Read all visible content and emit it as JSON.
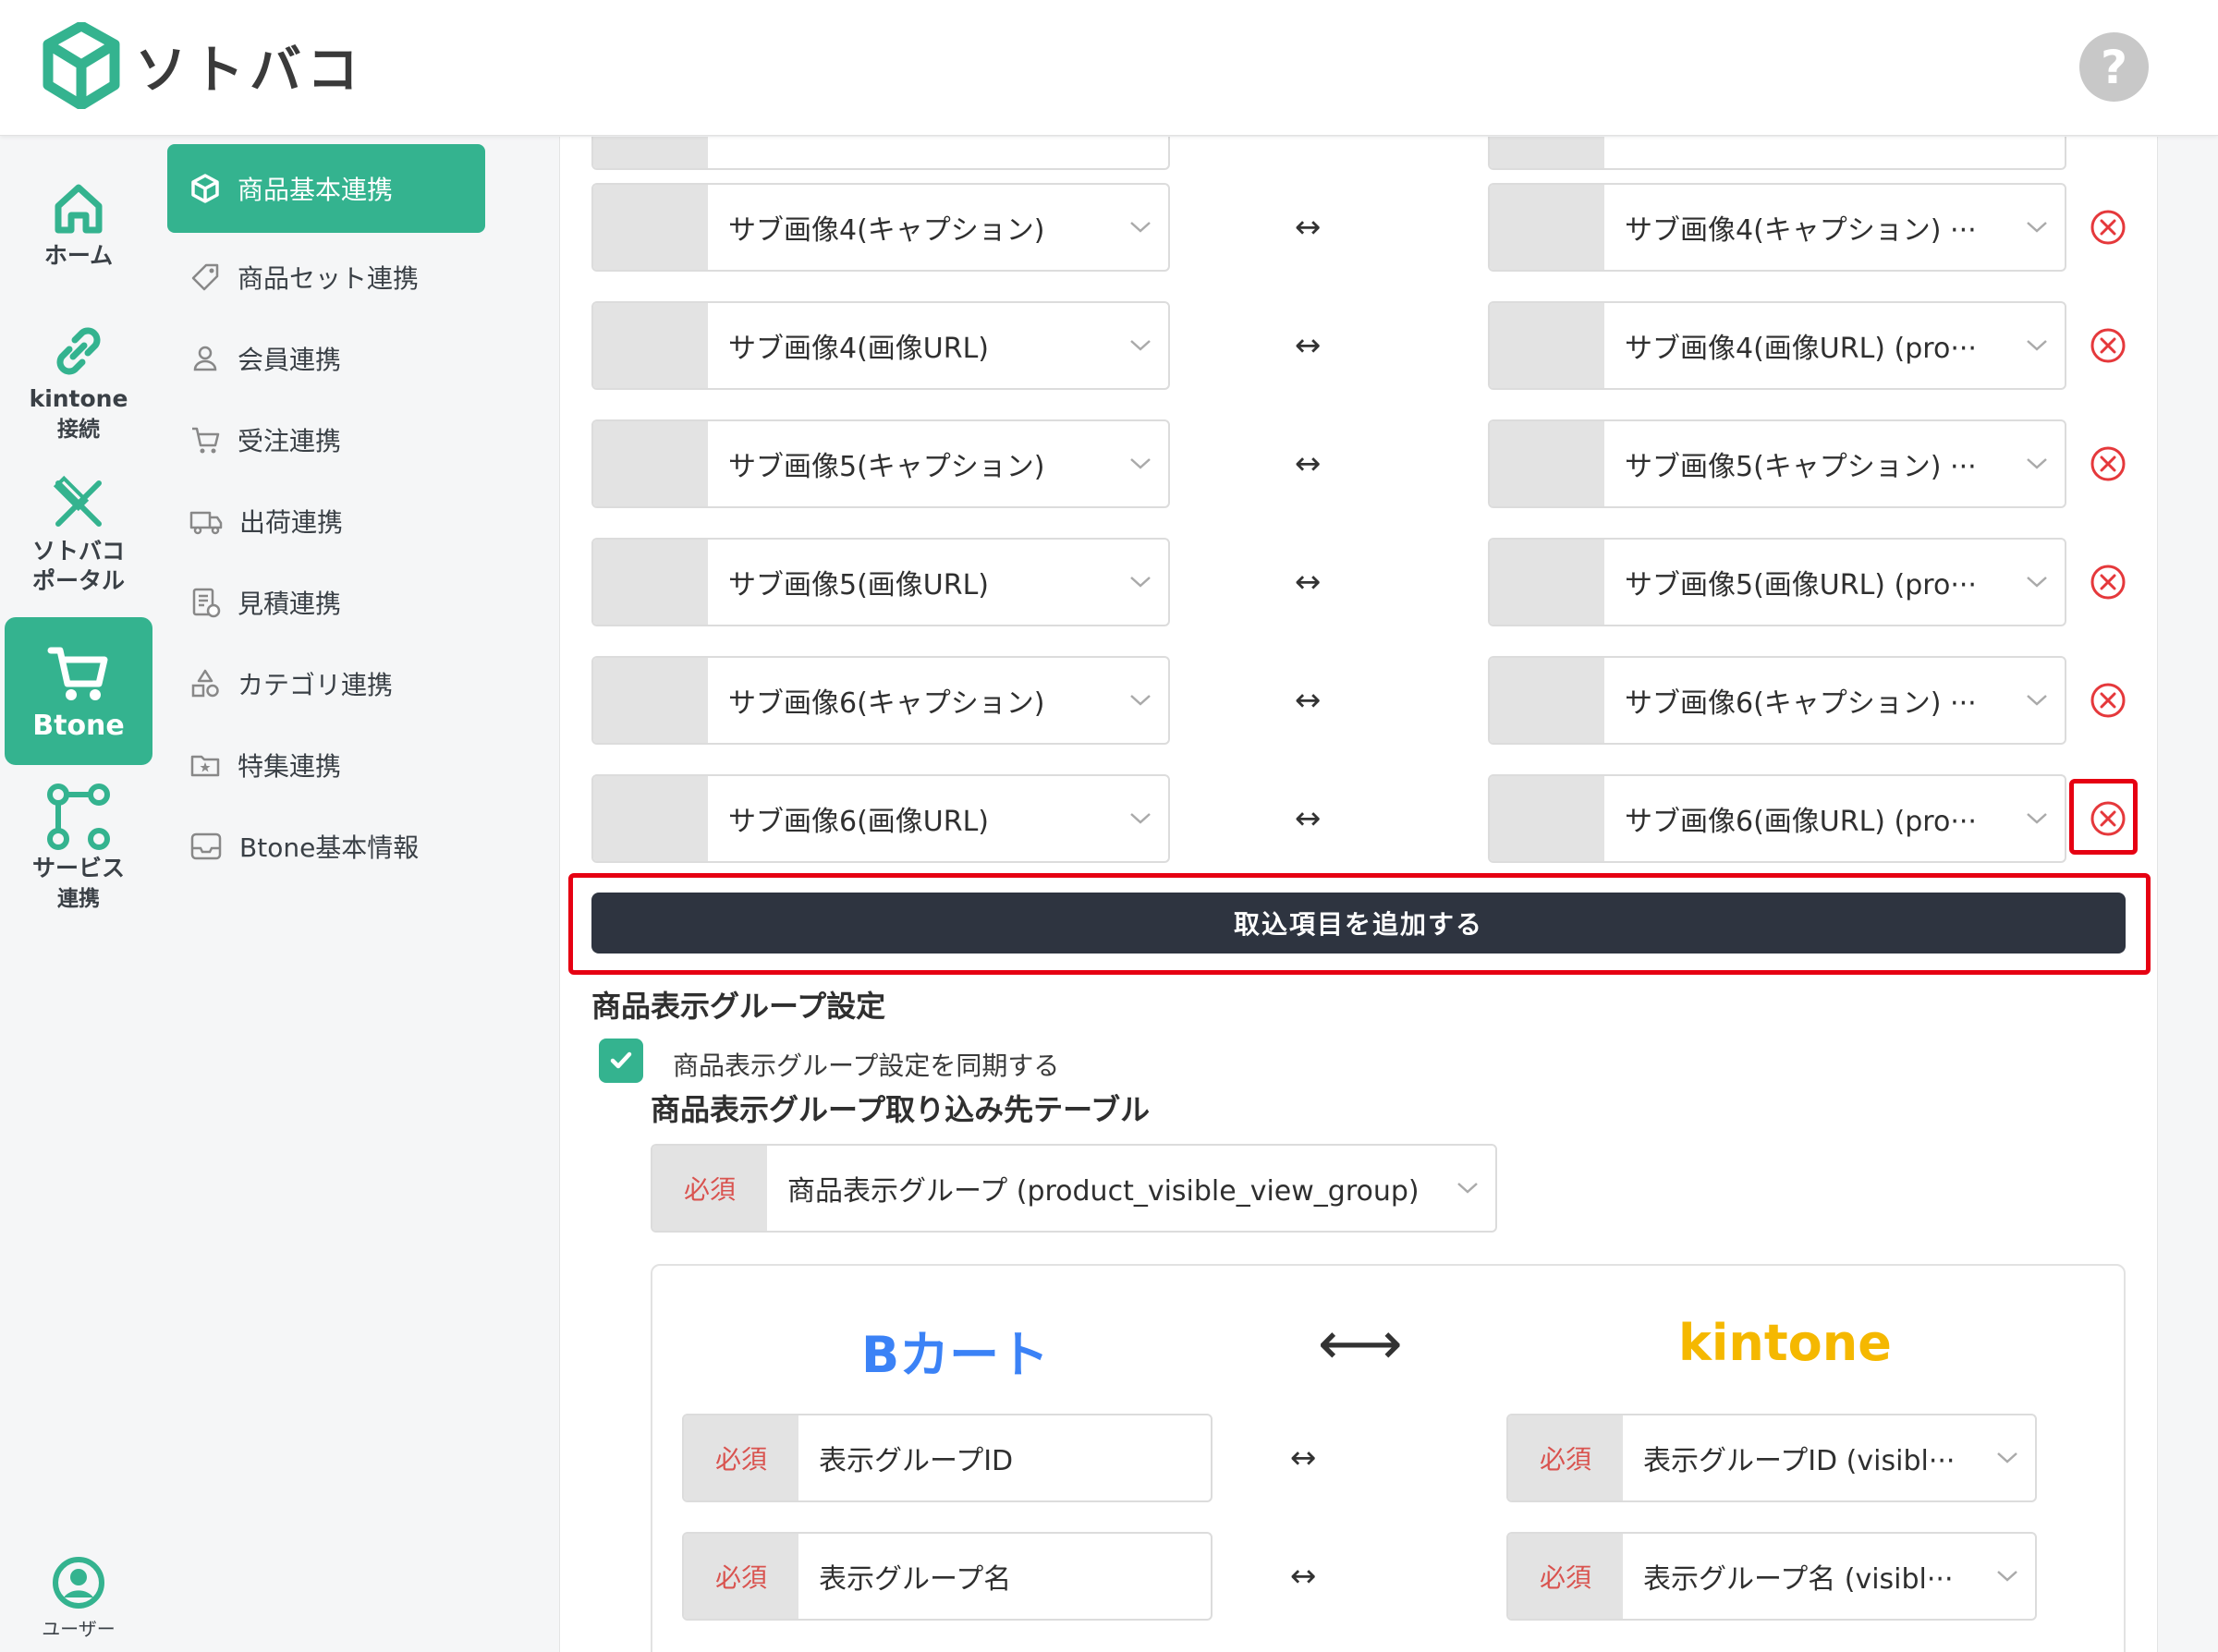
{
  "app": {
    "name": "ソトバコ",
    "help_label": "?"
  },
  "rail": [
    {
      "label": "ホーム",
      "icon": "home-icon"
    },
    {
      "label": "kintone\n接続",
      "icon": "link-icon"
    },
    {
      "label": "ソトバコ\nポータル",
      "icon": "portal-icon"
    },
    {
      "label": "Btone",
      "icon": "cart-icon",
      "active": true
    },
    {
      "label": "サービス\n連携",
      "icon": "service-link-icon"
    }
  ],
  "rail_user": "ユーザー",
  "subnav": [
    {
      "label": "商品基本連携",
      "icon": "box-icon",
      "active": true
    },
    {
      "label": "商品セット連携",
      "icon": "tag-icon"
    },
    {
      "label": "会員連携",
      "icon": "person-icon"
    },
    {
      "label": "受注連携",
      "icon": "cart-icon"
    },
    {
      "label": "出荷連携",
      "icon": "truck-icon"
    },
    {
      "label": "見積連携",
      "icon": "document-icon"
    },
    {
      "label": "カテゴリ連携",
      "icon": "shapes-icon"
    },
    {
      "label": "特集連携",
      "icon": "folder-star-icon"
    },
    {
      "label": "Btone基本情報",
      "icon": "inbox-icon"
    }
  ],
  "mapping_rows": [
    {
      "left": "サブ画像4(キャプション)",
      "right": "サブ画像4(キャプション) ···"
    },
    {
      "left": "サブ画像4(画像URL)",
      "right": "サブ画像4(画像URL) (pro···"
    },
    {
      "left": "サブ画像5(キャプション)",
      "right": "サブ画像5(キャプション) ···"
    },
    {
      "left": "サブ画像5(画像URL)",
      "right": "サブ画像5(画像URL) (pro···"
    },
    {
      "left": "サブ画像6(キャプション)",
      "right": "サブ画像6(キャプション) ···"
    },
    {
      "left": "サブ画像6(画像URL)",
      "right": "サブ画像6(画像URL) (pro···"
    }
  ],
  "arrow_symbol": "↔",
  "big_arrow_symbol": "⟷",
  "add_button": "取込項目を追加する",
  "group_section": {
    "title": "商品表示グループ設定",
    "sync_label": "商品表示グループ設定を同期する",
    "sync_checked": true,
    "table_title": "商品表示グループ取り込み先テーブル",
    "required": "必須",
    "table_select": "商品表示グループ (product_visible_view_group)",
    "left_header": "Bカート",
    "right_header": "kintone",
    "rows": [
      {
        "left": "表示グループID",
        "right": "表示グループID (visibl···"
      },
      {
        "left": "表示グループ名",
        "right": "表示グループ名 (visibl···"
      }
    ]
  },
  "colors": {
    "accent": "#34b38f",
    "highlight": "#e60012",
    "bcart": "#3b82f6",
    "kintone": "#f5b800",
    "delete": "#e5383b",
    "button_dark": "#2e3440"
  }
}
